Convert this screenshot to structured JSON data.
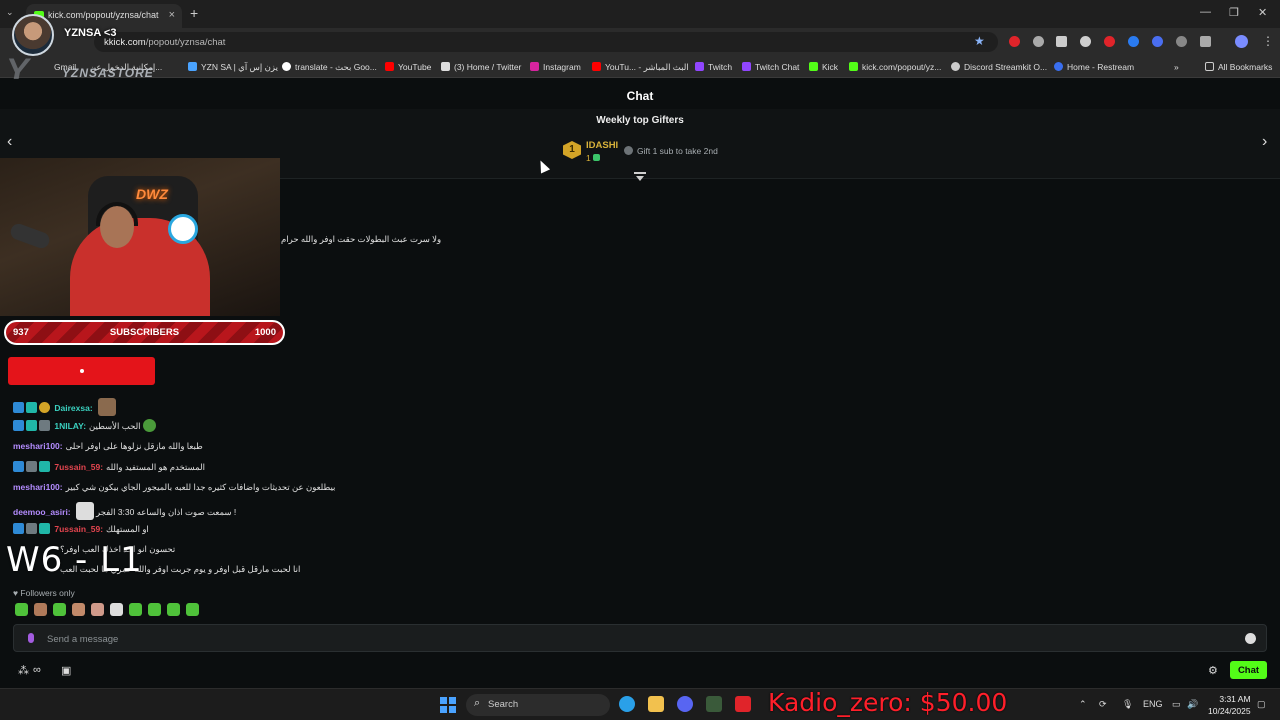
{
  "browser": {
    "tab_title": "kick.com/popout/yznsa/chat",
    "url_prefix": "k",
    "url_host": "kick.com",
    "url_path": "/popout/yznsa/chat",
    "bookmarks": [
      "Gmail",
      "إمكانية الدخول عن...",
      "YZN SA | يزن إس آي",
      "translate - بحث Goo...",
      "YouTube",
      "(3) Home / Twitter",
      "Instagram",
      "YouTu... - البث المباشر",
      "Twitch",
      "Twitch Chat",
      "Kick",
      "kick.com/popout/yz...",
      "Discord Streamkit O...",
      "Home - Restream"
    ],
    "all_bookmarks": "All Bookmarks"
  },
  "overlay": {
    "streamer_name": "YZNSA <3",
    "store_label": "YZNSASTORE",
    "sub_goal_current": "937",
    "sub_goal_label": "SUBSCRIBERS",
    "sub_goal_target": "1000",
    "sub_goal_progress": 0.937,
    "scene_label": "W6 - L1",
    "donation_text": "Kadio_zero: $50.00"
  },
  "chat": {
    "title": "Chat",
    "gifters_title": "Weekly top Gifters",
    "top_gifter": {
      "rank": "1",
      "name": "IDASHI",
      "count": "1"
    },
    "gift_cta": "Gift 1 sub to take 2nd",
    "messages": [
      {
        "user": "",
        "text": "ولا سرت عبث البطولات حقت اوفر والله حرام",
        "color": "#e0e0e0"
      },
      {
        "user": "Dairexsa:",
        "text": "",
        "color": "#3bd1c0"
      },
      {
        "user": "1NILAY:",
        "text": "الحب الأسطين",
        "color": "#3bd1c0"
      },
      {
        "user": "meshari100:",
        "text": "طبعا والله مازقل نزلوها على اوفر احلى",
        "color": "#b48cff"
      },
      {
        "user": "7ussain_59:",
        "text": "المستخدم هو المستفيد والله",
        "color": "#e4454f"
      },
      {
        "user": "meshari100:",
        "text": "بيطلعون عن تحديثات واضافات كثيره جدا للعبه بالميجور الجاي بيكون شي كبير",
        "color": "#b48cff"
      },
      {
        "user": "deemoo_asiri:",
        "text": "سمعت صوت اذان والساعه 3:30 الفجر !",
        "color": "#b48cff"
      },
      {
        "user": "7ussain_59:",
        "text": "او المستهلك",
        "color": "#e4454f"
      },
      {
        "user": "",
        "text": "تحسون انو احد اخذك العب اوفر؟",
        "color": "#e0e0e0"
      },
      {
        "user": "",
        "text": "انا لحبت مارقل قبل اوفر و يوم جربت اوفر والله عمري ما لحبت العب",
        "color": "#e0e0e0"
      }
    ],
    "followers_only": "Followers only",
    "input_placeholder": "Send a message",
    "send_button": "Chat"
  },
  "taskbar": {
    "search_label": "Search",
    "language": "ENG",
    "time": "3:31 AM",
    "date": "10/24/2025"
  }
}
